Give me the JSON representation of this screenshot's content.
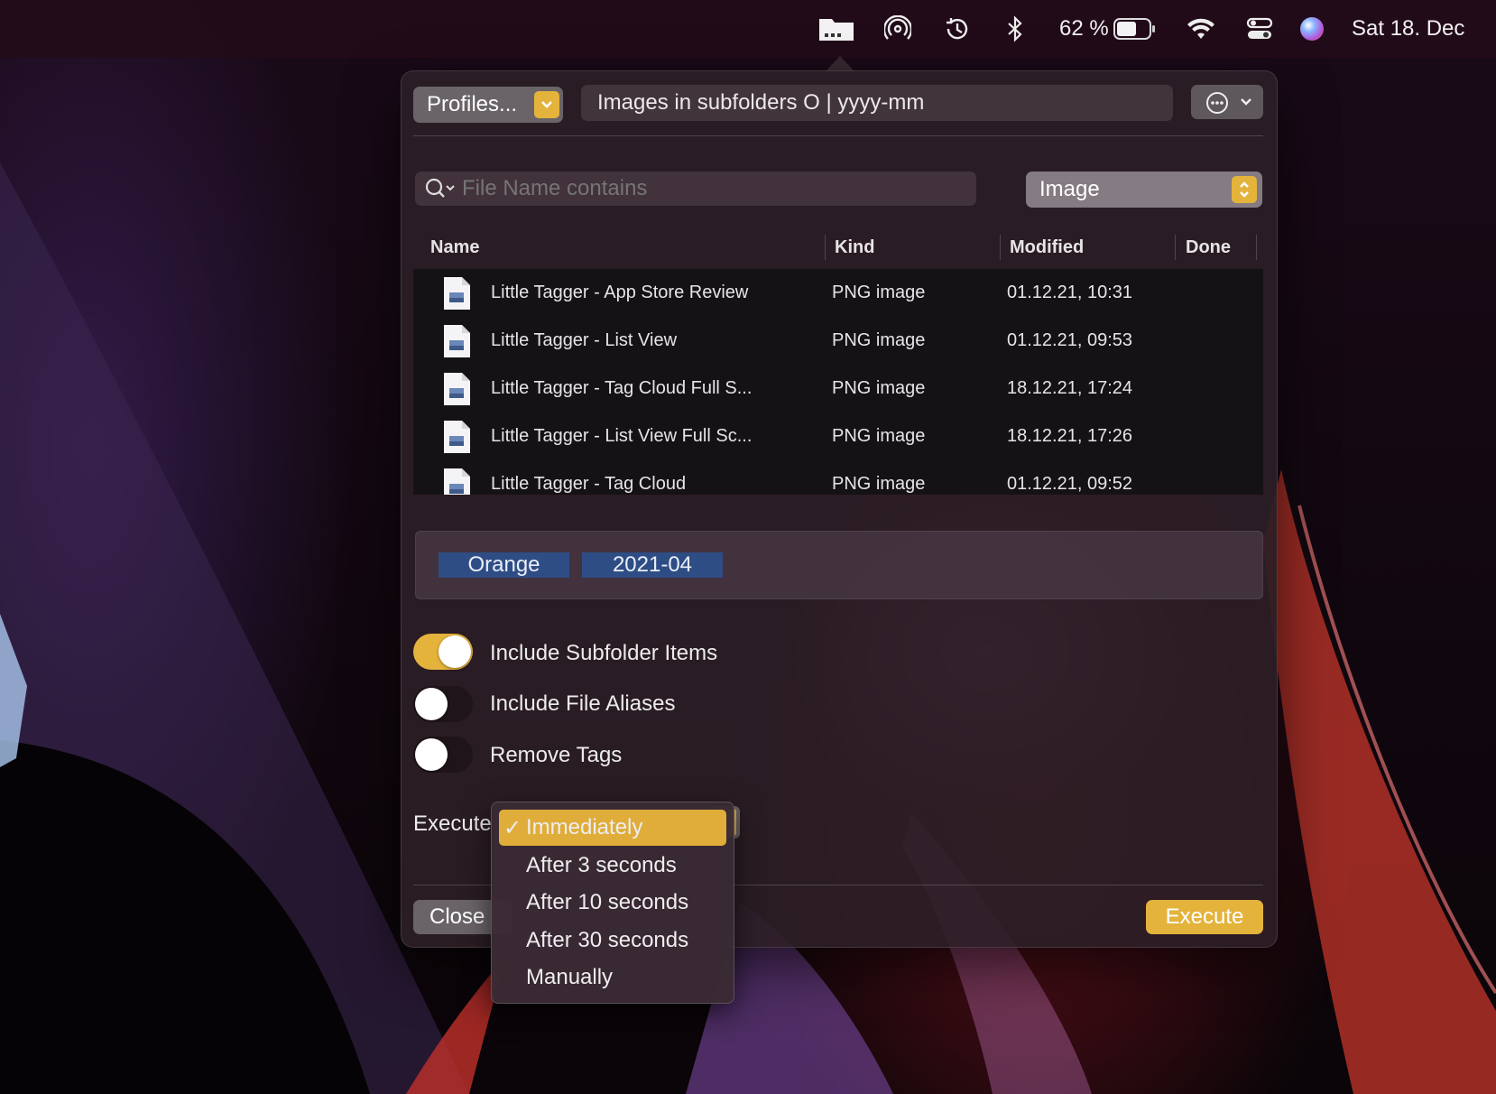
{
  "menubar": {
    "battery_percent_text": "62 %",
    "battery_level": 0.62,
    "datetime": "Sat 18. Dec",
    "icons": [
      "folder-tagger-icon",
      "airdrop-icon",
      "time-machine-icon",
      "bluetooth-icon",
      "battery-icon",
      "wifi-icon",
      "control-center-icon",
      "siri-icon"
    ]
  },
  "header": {
    "profiles_label": "Profiles...",
    "profile_name": "Images in subfolders O | yyyy-mm"
  },
  "search": {
    "placeholder": "File Name contains",
    "kind_value": "Image"
  },
  "table": {
    "columns": [
      "Name",
      "Kind",
      "Modified",
      "Done"
    ],
    "rows": [
      {
        "name": "Little Tagger - App Store Review",
        "kind": "PNG image",
        "modified": "01.12.21, 10:31",
        "done": ""
      },
      {
        "name": "Little Tagger - List View",
        "kind": "PNG image",
        "modified": "01.12.21, 09:53",
        "done": ""
      },
      {
        "name": "Little Tagger - Tag Cloud Full S...",
        "kind": "PNG image",
        "modified": "18.12.21, 17:24",
        "done": ""
      },
      {
        "name": "Little Tagger - List View Full Sc...",
        "kind": "PNG image",
        "modified": "18.12.21, 17:26",
        "done": ""
      },
      {
        "name": "Little Tagger - Tag Cloud",
        "kind": "PNG image",
        "modified": "01.12.21, 09:52",
        "done": ""
      }
    ]
  },
  "tags": [
    "Orange",
    "2021-04"
  ],
  "options": [
    {
      "label": "Include Subfolder Items",
      "on": true
    },
    {
      "label": "Include File Aliases",
      "on": false
    },
    {
      "label": "Remove Tags",
      "on": false
    }
  ],
  "execute": {
    "label": "Execute",
    "menu": [
      "Immediately",
      "After 3 seconds",
      "After 10 seconds",
      "After 30 seconds",
      "Manually"
    ],
    "selected": "Immediately",
    "checkmark": "✓"
  },
  "footer": {
    "close_label": "Close",
    "execute_label": "Execute"
  },
  "colors": {
    "accent": "#e4b33c",
    "tag_bg": "#2f4d85",
    "panel_bg": "#2c1e26"
  }
}
